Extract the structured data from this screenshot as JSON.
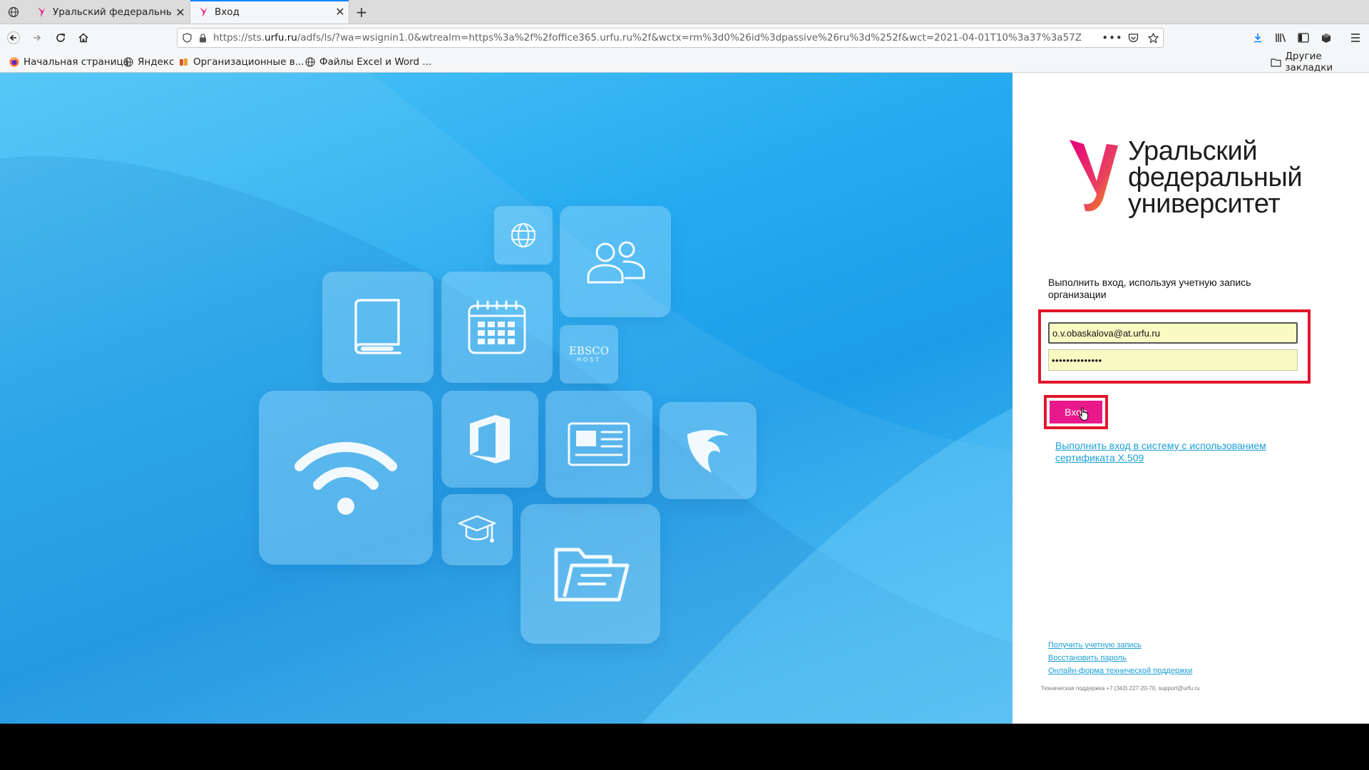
{
  "browser": {
    "tabs": [
      {
        "title": "Уральский федеральный",
        "favicon": "urfu-logo-icon"
      },
      {
        "title": "Вход",
        "favicon": "urfu-logo-icon",
        "active": true
      }
    ],
    "url_prefix": "https://sts.",
    "url_domain": "urfu.ru",
    "url_rest": "/adfs/ls/?wa=wsignin1.0&wtrealm=https%3a%2f%2foffice365.urfu.ru%2f&wctx=rm%3d0%26id%3dpassive%26ru%3d%252f&wct=2021-04-01T10%3a37%3a57Z",
    "bookmarks": [
      {
        "label": "Начальная страница",
        "icon": "firefox-icon"
      },
      {
        "label": "Яндекс",
        "icon": "globe-icon"
      },
      {
        "label": "Организационные в...",
        "icon": "bookmark-icon"
      },
      {
        "label": "Файлы Excel и Word ...",
        "icon": "globe-icon"
      }
    ],
    "other_bookmarks": "Другие закладки"
  },
  "logo": {
    "line1": "Уральский",
    "line2": "федеральный",
    "line3": "университет"
  },
  "login": {
    "prompt": "Выполнить вход, используя учетную запись организации",
    "email": "o.v.obaskalova@at.urfu.ru",
    "password_masked": "••••••••••••••",
    "button": "Вход",
    "cert_link": "Выполнить вход в систему с использованием сертификата X.509"
  },
  "footer": {
    "links": [
      "Получить учетную запись",
      "Восстановить пароль",
      "Онлайн-форма технической поддержки"
    ],
    "support": "Техническая поддержка +7 (343) 227-20-70, support@urfu.ru"
  },
  "hero": {
    "tile_labels": {
      "ebsco_line1": "EBSCO",
      "ebsco_line2": "HOST"
    }
  },
  "colors": {
    "accent": "#e9198b",
    "highlight": "#e2162b",
    "link": "#1a9fd8",
    "field_bg": "#fafac3"
  }
}
